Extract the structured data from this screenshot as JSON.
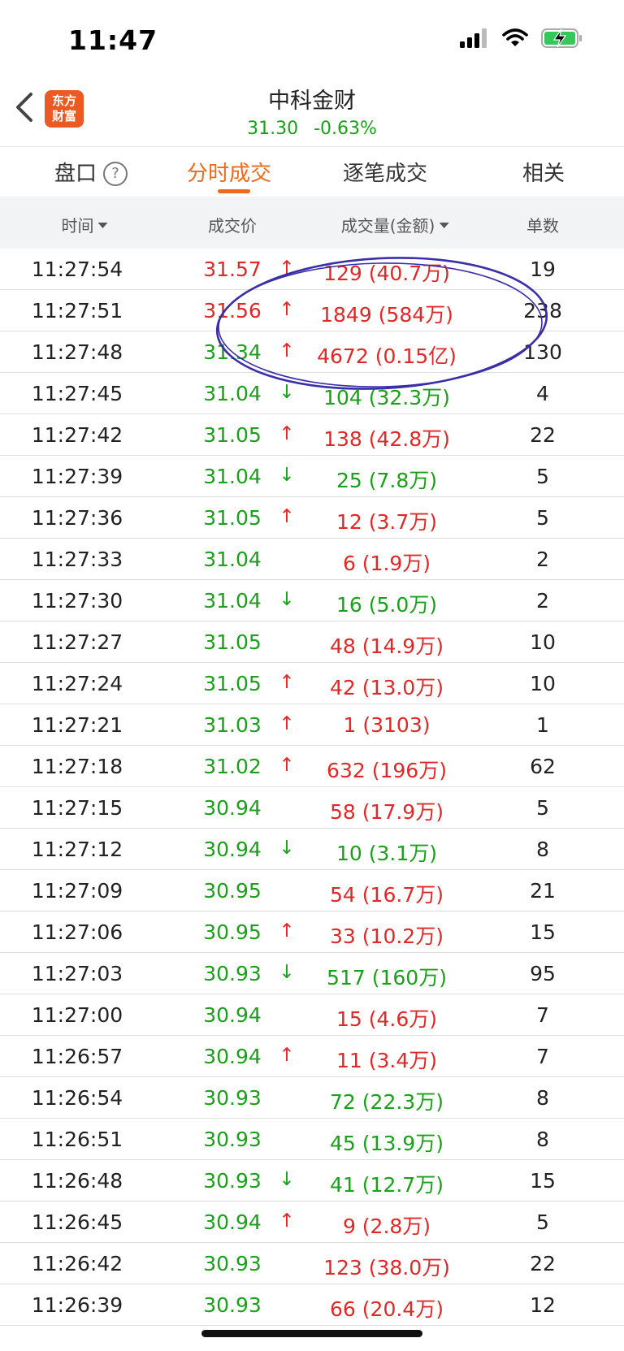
{
  "status": {
    "time": "11:47"
  },
  "nav": {
    "logo_line1": "东方",
    "logo_line2": "财富",
    "title": "中科金财",
    "price": "31.30",
    "change": "-0.63%"
  },
  "tabs": [
    {
      "label": "盘口"
    },
    {
      "label": "分时成交"
    },
    {
      "label": "逐笔成交"
    },
    {
      "label": "相关"
    }
  ],
  "help_glyph": "?",
  "columns": {
    "time": "时间",
    "price": "成交价",
    "volume": "成交量(金额)",
    "count": "单数"
  },
  "colors": {
    "up": "#e02828",
    "down": "#1aa01a",
    "accent": "#ec6a1e",
    "annotation": "#3a2fa8"
  },
  "trades": [
    {
      "time": "11:27:54",
      "price": "31.57",
      "price_dir": "up",
      "arrow": "↑",
      "volume": "129 (40.7万)",
      "vol_dir": "up",
      "count": "19"
    },
    {
      "time": "11:27:51",
      "price": "31.56",
      "price_dir": "up",
      "arrow": "↑",
      "volume": "1849 (584万)",
      "vol_dir": "up",
      "count": "238"
    },
    {
      "time": "11:27:48",
      "price": "31.34",
      "price_dir": "down",
      "arrow": "↑",
      "volume": "4672 (0.15亿)",
      "vol_dir": "up",
      "count": "130"
    },
    {
      "time": "11:27:45",
      "price": "31.04",
      "price_dir": "down",
      "arrow": "↓",
      "volume": "104 (32.3万)",
      "vol_dir": "down",
      "count": "4"
    },
    {
      "time": "11:27:42",
      "price": "31.05",
      "price_dir": "down",
      "arrow": "↑",
      "volume": "138 (42.8万)",
      "vol_dir": "up",
      "count": "22"
    },
    {
      "time": "11:27:39",
      "price": "31.04",
      "price_dir": "down",
      "arrow": "↓",
      "volume": "25 (7.8万)",
      "vol_dir": "down",
      "count": "5"
    },
    {
      "time": "11:27:36",
      "price": "31.05",
      "price_dir": "down",
      "arrow": "↑",
      "volume": "12 (3.7万)",
      "vol_dir": "up",
      "count": "5"
    },
    {
      "time": "11:27:33",
      "price": "31.04",
      "price_dir": "down",
      "arrow": "",
      "volume": "6 (1.9万)",
      "vol_dir": "up",
      "count": "2"
    },
    {
      "time": "11:27:30",
      "price": "31.04",
      "price_dir": "down",
      "arrow": "↓",
      "volume": "16 (5.0万)",
      "vol_dir": "down",
      "count": "2"
    },
    {
      "time": "11:27:27",
      "price": "31.05",
      "price_dir": "down",
      "arrow": "",
      "volume": "48 (14.9万)",
      "vol_dir": "up",
      "count": "10"
    },
    {
      "time": "11:27:24",
      "price": "31.05",
      "price_dir": "down",
      "arrow": "↑",
      "volume": "42 (13.0万)",
      "vol_dir": "up",
      "count": "10"
    },
    {
      "time": "11:27:21",
      "price": "31.03",
      "price_dir": "down",
      "arrow": "↑",
      "volume": "1 (3103)",
      "vol_dir": "up",
      "count": "1"
    },
    {
      "time": "11:27:18",
      "price": "31.02",
      "price_dir": "down",
      "arrow": "↑",
      "volume": "632 (196万)",
      "vol_dir": "up",
      "count": "62"
    },
    {
      "time": "11:27:15",
      "price": "30.94",
      "price_dir": "down",
      "arrow": "",
      "volume": "58 (17.9万)",
      "vol_dir": "up",
      "count": "5"
    },
    {
      "time": "11:27:12",
      "price": "30.94",
      "price_dir": "down",
      "arrow": "↓",
      "volume": "10 (3.1万)",
      "vol_dir": "down",
      "count": "8"
    },
    {
      "time": "11:27:09",
      "price": "30.95",
      "price_dir": "down",
      "arrow": "",
      "volume": "54 (16.7万)",
      "vol_dir": "up",
      "count": "21"
    },
    {
      "time": "11:27:06",
      "price": "30.95",
      "price_dir": "down",
      "arrow": "↑",
      "volume": "33 (10.2万)",
      "vol_dir": "up",
      "count": "15"
    },
    {
      "time": "11:27:03",
      "price": "30.93",
      "price_dir": "down",
      "arrow": "↓",
      "volume": "517 (160万)",
      "vol_dir": "down",
      "count": "95"
    },
    {
      "time": "11:27:00",
      "price": "30.94",
      "price_dir": "down",
      "arrow": "",
      "volume": "15 (4.6万)",
      "vol_dir": "up",
      "count": "7"
    },
    {
      "time": "11:26:57",
      "price": "30.94",
      "price_dir": "down",
      "arrow": "↑",
      "volume": "11 (3.4万)",
      "vol_dir": "up",
      "count": "7"
    },
    {
      "time": "11:26:54",
      "price": "30.93",
      "price_dir": "down",
      "arrow": "",
      "volume": "72 (22.3万)",
      "vol_dir": "down",
      "count": "8"
    },
    {
      "time": "11:26:51",
      "price": "30.93",
      "price_dir": "down",
      "arrow": "",
      "volume": "45 (13.9万)",
      "vol_dir": "down",
      "count": "8"
    },
    {
      "time": "11:26:48",
      "price": "30.93",
      "price_dir": "down",
      "arrow": "↓",
      "volume": "41 (12.7万)",
      "vol_dir": "down",
      "count": "15"
    },
    {
      "time": "11:26:45",
      "price": "30.94",
      "price_dir": "down",
      "arrow": "↑",
      "volume": "9 (2.8万)",
      "vol_dir": "up",
      "count": "5"
    },
    {
      "time": "11:26:42",
      "price": "30.93",
      "price_dir": "down",
      "arrow": "",
      "volume": "123 (38.0万)",
      "vol_dir": "up",
      "count": "22"
    },
    {
      "time": "11:26:39",
      "price": "30.93",
      "price_dir": "down",
      "arrow": "",
      "volume": "66 (20.4万)",
      "vol_dir": "up",
      "count": "12"
    }
  ]
}
